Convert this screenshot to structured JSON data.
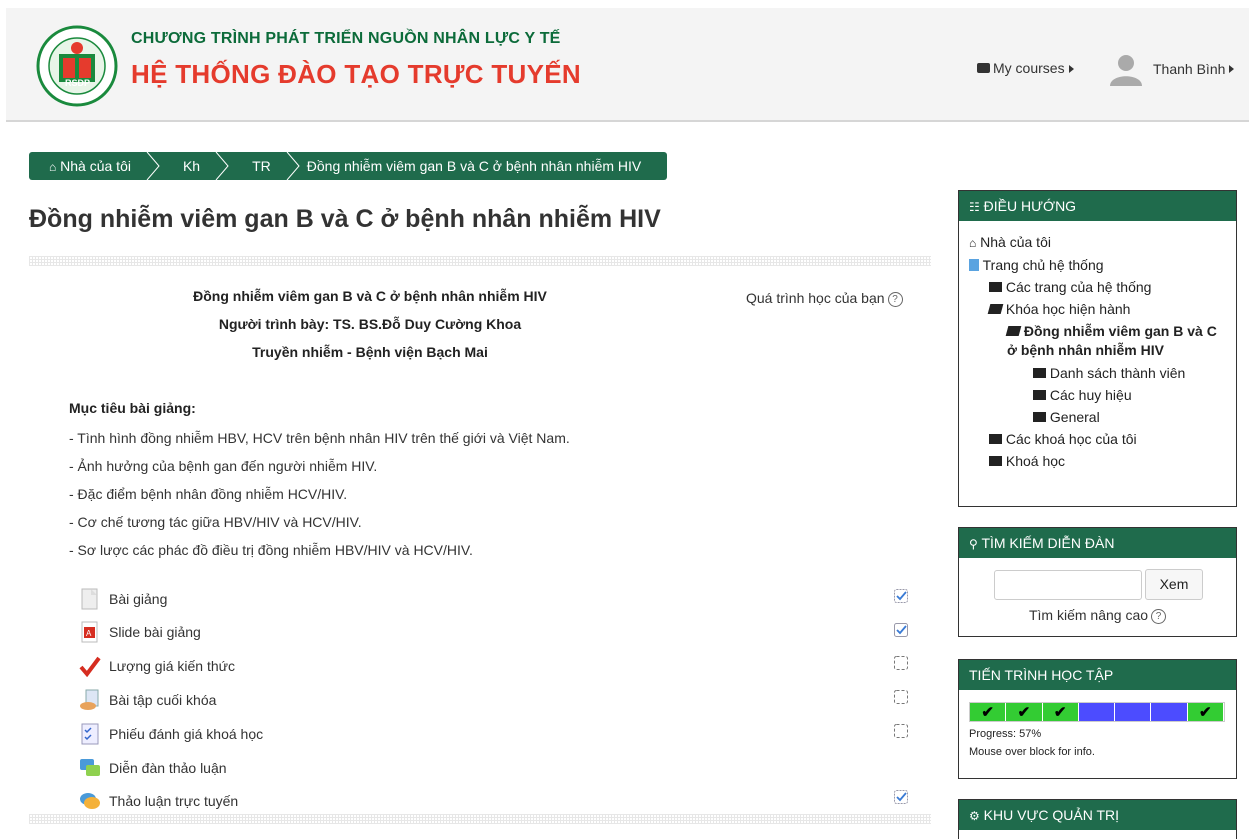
{
  "header": {
    "brand_line1": "CHƯƠNG TRÌNH PHÁT TRIỂN NGUỒN NHÂN LỰC Y TẾ",
    "brand_line2": "HỆ THỐNG ĐÀO TẠO TRỰC TUYẾN",
    "logo_text": "RSDP",
    "my_courses": "My courses",
    "user_name": "Thanh Bình"
  },
  "breadcrumb": [
    "Nhà của tôi",
    "Kh",
    "TR",
    "Đồng nhiễm viêm gan B và C ở bệnh nhân nhiễm HIV"
  ],
  "page_title": "Đồng nhiễm viêm gan B và C ở bệnh nhân nhiễm HIV",
  "intro": {
    "line1": "Đồng nhiễm viêm gan B và C ở bệnh nhân nhiễm HIV",
    "line2": "Người trình bày: TS. BS.Đỗ Duy Cường Khoa",
    "line3": "Truyền nhiễm - Bệnh viện Bạch Mai"
  },
  "progress_help": "Quá trình học của bạn",
  "objectives": {
    "title": "Mục tiêu bài giảng:",
    "items": [
      "- Tình hình đồng nhiễm HBV, HCV trên bệnh nhân HIV trên thế giới và Việt Nam.",
      "- Ảnh hưởng của bệnh gan đến người nhiễm HIV.",
      "- Đặc điểm bệnh nhân đồng nhiễm HCV/HIV.",
      "- Cơ chế tương tác giữa HBV/HIV và HCV/HIV.",
      "- Sơ lược các phác đồ điều trị đồng nhiễm HBV/HIV và HCV/HIV."
    ]
  },
  "activities": [
    {
      "label": "Bài giảng",
      "icon": "page-icon",
      "completion": "checked"
    },
    {
      "label": "Slide bài giảng",
      "icon": "pdf-icon",
      "completion": "checked"
    },
    {
      "label": "Lượng giá kiến thức",
      "icon": "quiz-check-icon",
      "completion": "unchecked"
    },
    {
      "label": "Bài tập cuối khóa",
      "icon": "assignment-icon",
      "completion": "unchecked"
    },
    {
      "label": "Phiếu đánh giá khoá học",
      "icon": "feedback-icon",
      "completion": "unchecked"
    },
    {
      "label": "Diễn đàn thảo luận",
      "icon": "forum-icon",
      "completion": "none"
    },
    {
      "label": "Thảo luận trực tuyến",
      "icon": "chat-icon",
      "completion": "checked"
    }
  ],
  "nav_block": {
    "title": "ĐIỀU HƯỚNG",
    "items": [
      {
        "label": "Nhà của tôi",
        "icon": "home-icon",
        "level": 0
      },
      {
        "label": "Trang chủ hệ thống",
        "icon": "page-icon",
        "level": 0
      },
      {
        "label": "Các trang của hệ thống",
        "icon": "folder-icon",
        "level": 1
      },
      {
        "label": "Khóa học hiện hành",
        "icon": "folder-open-icon",
        "level": 1
      },
      {
        "label": "Đồng nhiễm viêm gan B và C ở bệnh nhân nhiễm HIV",
        "icon": "folder-open-icon",
        "level": 2,
        "bold": true
      },
      {
        "label": "Danh sách thành viên",
        "icon": "folder-icon",
        "level": 3
      },
      {
        "label": "Các huy hiệu",
        "icon": "folder-icon",
        "level": 3
      },
      {
        "label": "General",
        "icon": "folder-icon",
        "level": 3
      },
      {
        "label": "Các khoá học của tôi",
        "icon": "folder-icon",
        "level": 1
      },
      {
        "label": "Khoá học",
        "icon": "folder-icon",
        "level": 1
      }
    ]
  },
  "search_block": {
    "title": "TÌM KIẾM DIỄN ĐÀN",
    "button": "Xem",
    "advanced": "Tìm kiếm nâng cao"
  },
  "progress_block": {
    "title": "TIẾN TRÌNH HỌC TẬP",
    "cells": [
      "done",
      "done",
      "done",
      "todo",
      "todo",
      "todo",
      "done"
    ],
    "colors": {
      "done": "#33cc33",
      "todo": "#4c4cff"
    },
    "progress_text": "Progress: 57%",
    "info_text": "Mouse over block for info."
  },
  "admin_block": {
    "title": "KHU VỰC QUẢN TRỊ"
  }
}
